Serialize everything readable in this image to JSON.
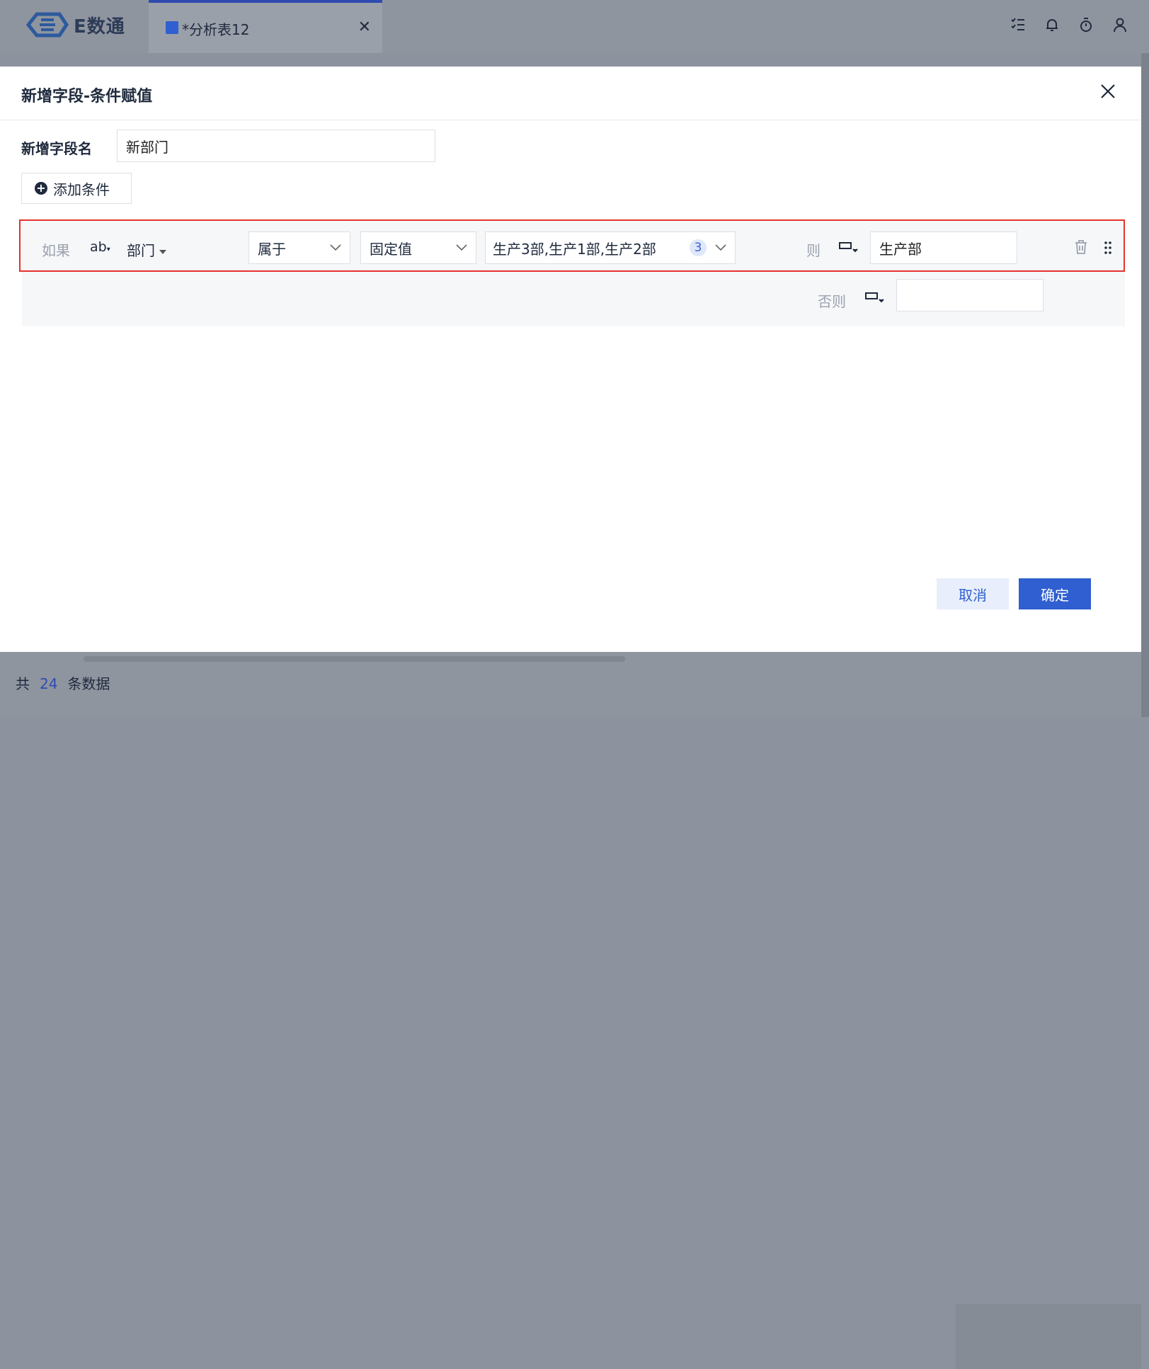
{
  "app": {
    "logo_text": "E数通",
    "tab_title": "*分析表12",
    "top_icons": [
      "task-list-icon",
      "bell-icon",
      "timer-icon",
      "user-icon"
    ]
  },
  "footer": {
    "prefix": "共",
    "count": "24",
    "suffix": "条数据"
  },
  "dialog": {
    "title": "新增字段-条件赋值",
    "field_name_label": "新增字段名",
    "field_name_value": "新部门",
    "add_condition_label": "添加条件",
    "condition": {
      "if_label": "如果",
      "field_type": "ab",
      "field_name": "部门",
      "operator": "属于",
      "value_mode": "固定值",
      "values_text": "生产3部,生产1部,生产2部",
      "values_count": "3",
      "then_label": "则",
      "then_value": "生产部"
    },
    "else": {
      "label": "否则",
      "value": ""
    },
    "cancel_label": "取消",
    "ok_label": "确定"
  },
  "colors": {
    "accent": "#2f5fd0",
    "highlight_border": "#e5322d",
    "overlay": "#8d939e"
  }
}
